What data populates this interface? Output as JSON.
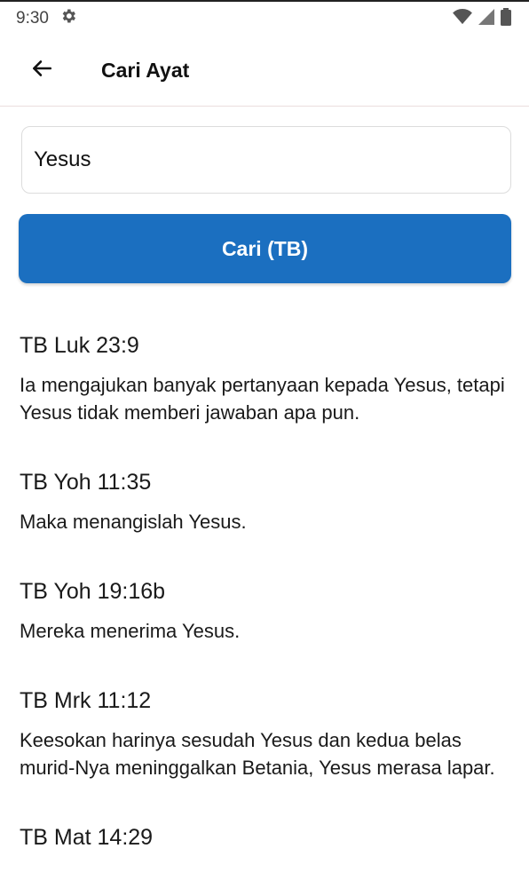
{
  "status_bar": {
    "time": "9:30",
    "icons": [
      "gear-icon",
      "wifi-icon",
      "signal-icon",
      "battery-icon"
    ]
  },
  "app_bar": {
    "back_icon": "arrow-left-icon",
    "title": "Cari Ayat"
  },
  "search": {
    "value": "Yesus",
    "button_label": "Cari (TB)",
    "button_color": "#1b6fc0"
  },
  "results": [
    {
      "ref": "TB Luk 23:9",
      "text": "Ia mengajukan banyak pertanyaan kepada Yesus, tetapi Yesus tidak memberi jawaban apa pun."
    },
    {
      "ref": "TB Yoh 11:35",
      "text": "Maka menangislah Yesus."
    },
    {
      "ref": "TB Yoh 19:16b",
      "text": "Mereka menerima Yesus."
    },
    {
      "ref": "TB Mrk 11:12",
      "text": "Keesokan harinya sesudah Yesus dan kedua belas murid-Nya meninggalkan Betania, Yesus merasa lapar."
    },
    {
      "ref": "TB Mat 14:29",
      "text": ""
    }
  ]
}
